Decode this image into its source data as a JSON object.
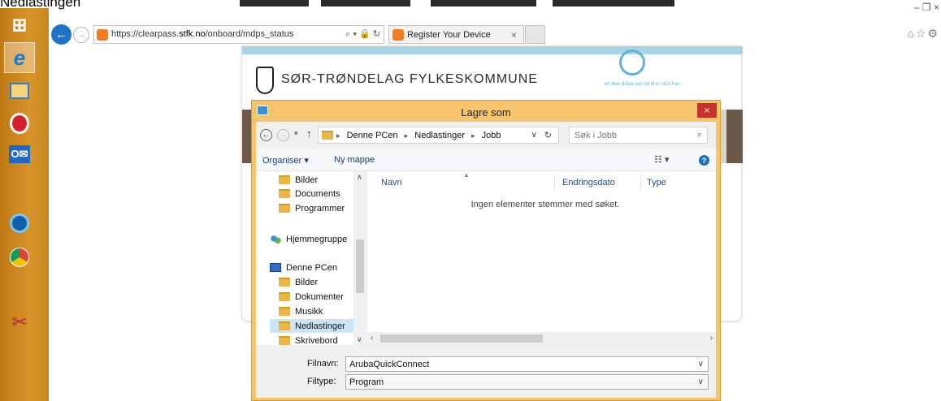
{
  "caption": "Nedlastingen",
  "window_controls": {
    "minimize": "–",
    "restore": "❐",
    "close": "×"
  },
  "taskbar": {
    "items": [
      {
        "icon": "windows-start-icon",
        "glyph": "⊞"
      },
      {
        "icon": "internet-explorer-icon",
        "glyph": "e"
      },
      {
        "icon": "file-explorer-icon",
        "glyph": "▤"
      },
      {
        "icon": "opera-icon",
        "glyph": "O"
      },
      {
        "icon": "outlook-icon",
        "glyph": "O"
      },
      {
        "icon": "zoom-search-icon",
        "glyph": "⊕"
      },
      {
        "icon": "chrome-icon",
        "glyph": "◉"
      },
      {
        "icon": "tools-icon",
        "glyph": "✂"
      }
    ]
  },
  "browser": {
    "url_prefix": "https://clearpass.",
    "url_domain": "stfk.no",
    "url_path": "/onboard/mdps_status",
    "address_tools": "⌕ ▾ 🔒 ↻",
    "tab_title": "Register Your Device",
    "tab_close": "×",
    "right_tools": "⌂☆⚙"
  },
  "page": {
    "org_name": "SØR-TRØNDELAG FYLKESKOMMUNE",
    "tagline": "en liten dråpe kan bli til et stort hav"
  },
  "dialog": {
    "title": "Lagre som",
    "close": "×",
    "path": [
      "Denne PCen",
      "Nedlastinger",
      "Jobb"
    ],
    "search_placeholder": "Søk i Jobb",
    "organize": "Organiser ▾",
    "new_folder": "Ny mappe",
    "view_icon": "☷ ▾",
    "help": "?",
    "nav_items": [
      {
        "label": "Bilder",
        "type": "folder"
      },
      {
        "label": "Documents",
        "type": "folder"
      },
      {
        "label": "Programmer",
        "type": "folder"
      },
      {
        "label": "Hjemmegruppe",
        "type": "homegroup"
      },
      {
        "label": "Denne PCen",
        "type": "pc"
      },
      {
        "label": "Bilder",
        "type": "folder"
      },
      {
        "label": "Dokumenter",
        "type": "folder"
      },
      {
        "label": "Musikk",
        "type": "folder"
      },
      {
        "label": "Nedlastinger",
        "type": "folder",
        "selected": true
      },
      {
        "label": "Skrivebord",
        "type": "folder"
      }
    ],
    "columns": [
      "Navn",
      "Endringsdato",
      "Type"
    ],
    "empty_message": "Ingen elementer stemmer med søket.",
    "filename_label": "Filnavn:",
    "filename_value": "ArubaQuickConnect",
    "filetype_label": "Filtype:",
    "filetype_value": "Program"
  }
}
